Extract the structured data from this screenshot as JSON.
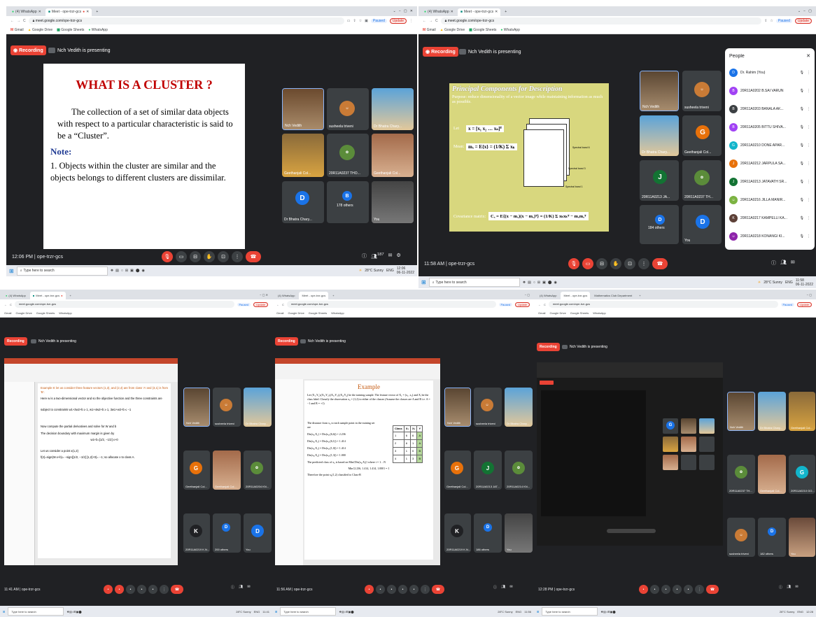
{
  "common": {
    "whatsapp_tab": "(4) WhatsApp",
    "meet_tab": "Meet - ope-trzr-gcs",
    "math_tab": "Mathematics Club Department",
    "url": "meet.google.com/ope-trzr-gcs",
    "paused": "Paused",
    "update": "Update",
    "bookmarks": [
      "Gmail",
      "Google Drive",
      "Google Sheets",
      "WhatsApp"
    ],
    "recording": "Recording",
    "presenting": "Nch Vedith is presenting",
    "meeting_code": "ope-trzr-gcs",
    "taskbar_search": "Type here to search",
    "weather": "28°C Sunny",
    "lang": "ENG",
    "date": "06-11-2022"
  },
  "shots": [
    {
      "time": "12:06 PM",
      "clock": "12:06",
      "hand_count": "187",
      "slide": {
        "title": "WHAT IS A CLUSTER ?",
        "body": "The collection of a set of similar data objects with respect to a particular characteristic is said to be a “Cluster”.",
        "note": "Note:",
        "point": "1.  Objects within the cluster are similar and the objects belongs to different clusters are dissimilar."
      },
      "tiles": [
        "Nch Vedith",
        "susheela triveni",
        "Dr Bhatra Chary...",
        "Geethanjali Col...",
        "20R11A0237 THO...",
        "Geethanjali Col...",
        "Dr Bhatra Chary...",
        "178 others",
        "You"
      ]
    },
    {
      "time": "11:58 AM",
      "clock": "11:58",
      "slide": {
        "title": "Principal Components for Description",
        "purpose": "Purpose: reduce dimensionality of a vector image while maintaining information as much as possible.",
        "let": "Let",
        "mean": "Mean:",
        "cov": "Covariance matrix:",
        "eq1": "x = [x₁  x₂  …  xₙ]ᵀ",
        "eq2": "mₓ = E{x} = (1/K) Σ xₖ",
        "eq3": "Cₓ = E{(x − mₓ)(x − mₓ)ᵀ} = (1/K) Σ xₖxₖᵀ − mₓmₓᵀ",
        "bands": [
          "Spectral band 6",
          "Spectral band 5",
          "Spectral band 4",
          "Spectral band 3",
          "Spectral band 2",
          "Spectral band 1"
        ]
      },
      "tiles": [
        "Nch Vedith",
        "susheela triveni",
        "Dr Bhatra Chary...",
        "Geethanjali Col...",
        "20R11A0213 JA...",
        "20R11A0237 TH...",
        "184 others",
        "You"
      ],
      "people": {
        "title": "People",
        "list": [
          "Dr. Rahim (You)",
          "20R11A0202 B.SAI VARUN",
          "20R11A0203 BANALA AK...",
          "20R11A0205 BITTU SHIVA...",
          "20R11A0210 DONE APAR...",
          "20R11A0212 JARPULA SA...",
          "20R11A0213 JATAVATH SR...",
          "20R11A0216 JILLA MANIR...",
          "20R11A0217 KAMPELLI KA...",
          "20R11A0218 KONANGI KI..."
        ]
      }
    },
    {
      "time": "11:41 AM",
      "clock": "11:41",
      "doc": {
        "title": "Example 8: let us consider three feature vectors (1,3), and (2,4) are from class ‘A’ and (3,1) is from ‘B’.",
        "l1": "Here w is a two-dimensional vector and so the objective function and the three constraints are",
        "l2": "subject to constraints  w1+3w2+b ≥ 1, w1+4w2+b ≥ 1, 3w1+w2+b ≤ −1",
        "l3": "Now compute the partial derivatives and solve for W and b",
        "l4": "The decision boundary with maximum margin is given by",
        "l5": "w1+b=[1/2, −1/2] x+0",
        "l6": "Let us consider a point x(1,2)",
        "l7": "f(2)=sign(W.x+b)= −sign([1/2, −1/2] [1,2]+0)= −1; so allocate x to class A."
      },
      "tiles": [
        "Nch Vedith",
        "susheela triveni",
        "Dr Bhatra Chary...",
        "Geethanjali Col...",
        "Geethanjali Col...",
        "20R11A0204 KN...",
        "20R11A0219 K.N...",
        "200 others",
        "You"
      ]
    },
    {
      "time": "11:56 AM",
      "clock": "11:56",
      "doc": {
        "title": "Example",
        "l1": "Let (X₁,Y₁),(X₂,Y₂),(X₃,Y₃),(X₄,Y₄) be the training sample. The feature vector of X₁ = (x₁, x₂) and Xᵢ be the class label. Classify the observation x₀ = (1,2) to either of the classes (Assume the classes are A and B i.e. A = −1 and B = +1)",
        "l2": "The distance from x₀ to each sample point in the training set are",
        "rows": [
          "Dis(x₀,X₁) = Dis(x₀,(6,6)) = 2.236",
          "Dis(x₀,X₂) = Dis(x₀,(6,1)) = 1.414",
          "Dis(x₀,X₃) = Dis(x₀,(1,0)) = 1.414",
          "Dis(x₀,X₄) = Dis(x₀,(1,3)) = 1.000"
        ],
        "l3": "The predicted class of x₀ is based on  Min{Dis(x₀,Xᵢ)} where i = 1…N",
        "l4": "Min{2.236, 1.414, 1.414, 1.000} = 1",
        "l5": "Therefore the point x₀(1,2) classified to Class-B",
        "table_head": [
          "Class",
          "X₁",
          "X₂",
          "Y"
        ],
        "table_rows": [
          [
            "1",
            "6",
            "6",
            "A"
          ],
          [
            "2",
            "6",
            "1",
            "A"
          ],
          [
            "3",
            "1",
            "0",
            "B"
          ],
          [
            "4",
            "1",
            "3",
            "B"
          ]
        ]
      },
      "tiles": [
        "Nch Vedith",
        "susheela triveni",
        "Dr Bhatra Chary...",
        "Geethanjali Col...",
        "20R11A0213 JAT...",
        "20R11A0214 KN...",
        "20R11A0219 K.N...",
        "186 others",
        "You"
      ]
    },
    {
      "time": "12:28 PM",
      "clock": "12:28",
      "tiles": [
        "Nch Vedith",
        "Dr Bhatra Chary...",
        "Geethanjali Col...",
        "20R11A0237 TH...",
        "Geethanjali Col...",
        "20R11A0210 GO...",
        "susheela triveni",
        "182 others",
        "You"
      ]
    }
  ]
}
